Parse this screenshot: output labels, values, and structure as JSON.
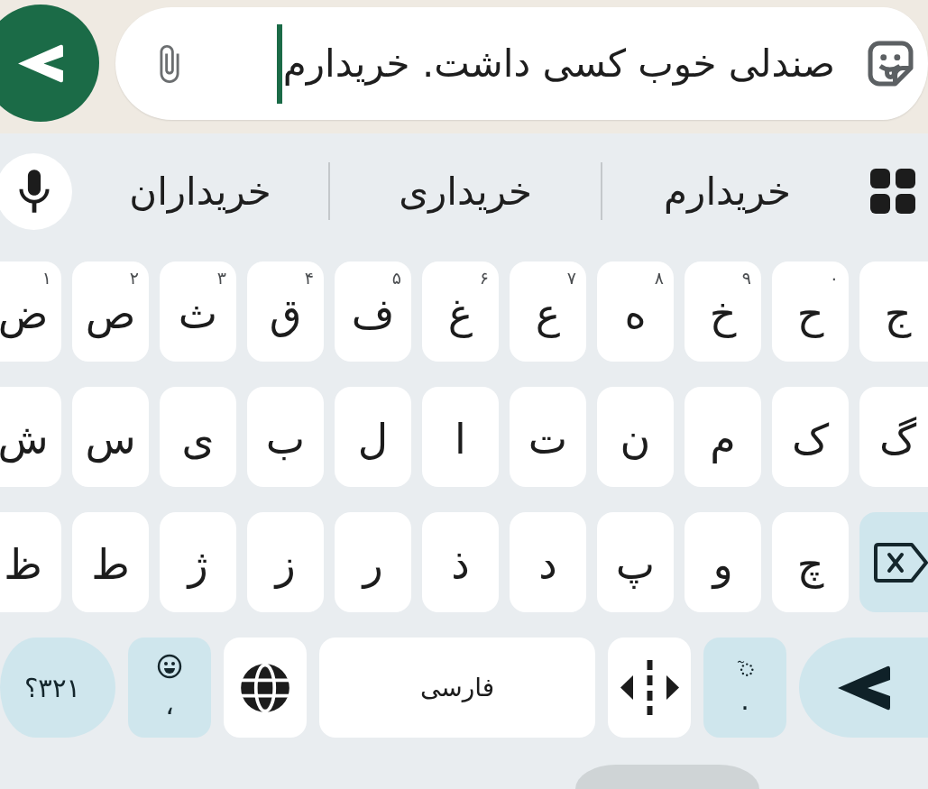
{
  "chat": {
    "message": {
      "value": "صندلی خوب کسی داشت. خریدارم"
    }
  },
  "suggestions": [
    "خریدارم",
    "خریداری",
    "خریداران"
  ],
  "keyboard": {
    "letter_rows": [
      [
        {
          "kind": "letter",
          "label": "ج"
        },
        {
          "kind": "letter",
          "label": "ح",
          "hint": "۰"
        },
        {
          "kind": "letter",
          "label": "خ",
          "hint": "۹"
        },
        {
          "kind": "letter",
          "label": "ه",
          "hint": "۸"
        },
        {
          "kind": "letter",
          "label": "ع",
          "hint": "۷"
        },
        {
          "kind": "letter",
          "label": "غ",
          "hint": "۶"
        },
        {
          "kind": "letter",
          "label": "ف",
          "hint": "۵"
        },
        {
          "kind": "letter",
          "label": "ق",
          "hint": "۴"
        },
        {
          "kind": "letter",
          "label": "ث",
          "hint": "۳"
        },
        {
          "kind": "letter",
          "label": "ص",
          "hint": "۲"
        },
        {
          "kind": "letter",
          "label": "ض",
          "hint": "۱"
        }
      ],
      [
        {
          "kind": "letter",
          "label": "گ"
        },
        {
          "kind": "letter",
          "label": "ک"
        },
        {
          "kind": "letter",
          "label": "م"
        },
        {
          "kind": "letter",
          "label": "ن"
        },
        {
          "kind": "letter",
          "label": "ت"
        },
        {
          "kind": "letter",
          "label": "ا"
        },
        {
          "kind": "letter",
          "label": "ل"
        },
        {
          "kind": "letter",
          "label": "ب"
        },
        {
          "kind": "letter",
          "label": "ی"
        },
        {
          "kind": "letter",
          "label": "س"
        },
        {
          "kind": "letter",
          "label": "ش"
        }
      ],
      [
        {
          "kind": "backspace"
        },
        {
          "kind": "letter",
          "label": "چ"
        },
        {
          "kind": "letter",
          "label": "و"
        },
        {
          "kind": "letter",
          "label": "پ"
        },
        {
          "kind": "letter",
          "label": "د"
        },
        {
          "kind": "letter",
          "label": "ذ"
        },
        {
          "kind": "letter",
          "label": "ر"
        },
        {
          "kind": "letter",
          "label": "ز"
        },
        {
          "kind": "letter",
          "label": "ژ"
        },
        {
          "kind": "letter",
          "label": "ط"
        },
        {
          "kind": "letter",
          "label": "ظ"
        }
      ]
    ],
    "bottom_row": [
      {
        "kind": "enter"
      },
      {
        "kind": "period",
        "label": "."
      },
      {
        "kind": "cursor"
      },
      {
        "kind": "space",
        "label": "فارسی"
      },
      {
        "kind": "language"
      },
      {
        "kind": "emoji",
        "label": "،"
      },
      {
        "kind": "symbols",
        "label": "۱۲۳؟"
      }
    ]
  }
}
